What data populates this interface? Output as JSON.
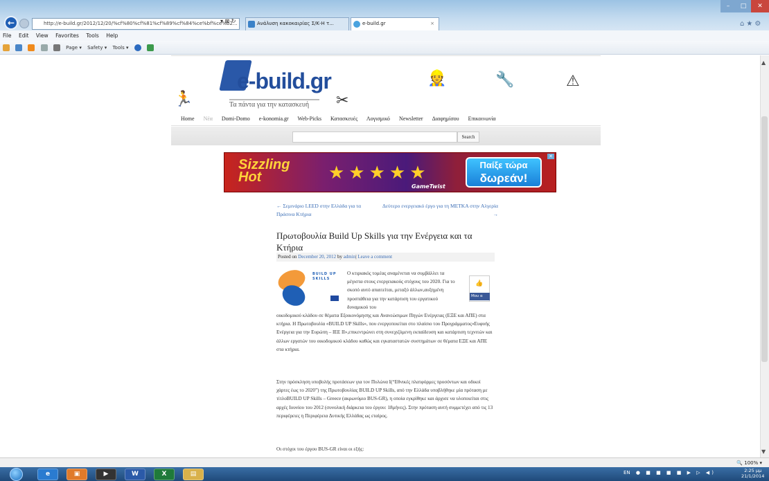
{
  "browser": {
    "address": "http://e-build.gr/2012/12/20/%cf%80%cf%81%cf%89%cf%84%ce%bf%ce%b2...",
    "tabs": [
      {
        "label": "Ανάλυση κακοκαιρίας Σ/Κ-Η τ..."
      },
      {
        "label": "e-build.gr"
      }
    ],
    "menu": [
      "File",
      "Edit",
      "View",
      "Favorites",
      "Tools",
      "Help"
    ],
    "commands": [
      "Page ▾",
      "Safety ▾",
      "Tools ▾"
    ],
    "zoom": "100%"
  },
  "site": {
    "logo": "e-build.gr",
    "tagline": "Τα πάντα για την κατασκευή",
    "nav": [
      "Home",
      "Nέα",
      "Domi-Domo",
      "e-konomia.gr",
      "Web-Picks",
      "Κατασκευές",
      "Λογισμικό",
      "Newsletter",
      "Διαφημίσου",
      "Επικοινωνία"
    ],
    "search_button": "Search"
  },
  "ad": {
    "left_text_1": "Sizzling",
    "left_text_2": "Hot",
    "brand": "GameTwist",
    "cta_1": "Παίξε τώρα",
    "cta_2": "δωρεάν!"
  },
  "post": {
    "prev": "← Σεμινάριο LEED στην Ελλάδα για τα Πράσινα Κτήρια",
    "next": "Δεύτερο ενεργειακό έργο για τη ΜΕΤΚΑ στην Αλγερία →",
    "title": "Πρωτοβουλία Build Up Skills για την Ενέργεια και τα Κτήρια",
    "meta_posted": "Posted on",
    "meta_date": "December 20, 2012",
    "meta_by": "by",
    "meta_author": "admin",
    "meta_sep": "|",
    "meta_comment": "Leave a comment",
    "image_text_1": "BUILD UP",
    "image_text_2": "SKILLS",
    "fb_label": "Μου α",
    "p1a": "Ο κτιριακός τομέας αναμένεται να συμβάλλει τα μέγιστα στους ενεργειακούς στόχους του 2020. Για το σκοπό αυτό απαιτείται, μεταξύ άλλων,αυξημένη προσπάθεια για την κατάρτιση του εργατικού δυναμικού του",
    "p1b": "οικοδομικού κλάδου σε θέματα Εξοικονόμησης και Ανανεώσιμων Πηγών Ενέργειας (ΕΞΕ και ΑΠΕ) στα κτήρια. Η Πρωτοβουλία «BUILD UP Skills», που ενεργοποιείται στο πλαίσιο του Προγράμματος«Ευφυής Ενέργεια για την Ευρώπη – ΙΕΕ ΙΙ»,επικεντρώνει στη συνεχιζόμενη εκπαίδευση και κατάρτιση τεχνιτών και άλλων εργατών του οικοδομικού κλάδου καθώς και εγκαταστατών συστημάτων σε θέματα ΕΞΕ και ΑΠΕ στα κτήρια.",
    "p2": "Στην πρόσκληση υποβολής προτάσεων για τον Πυλώνα Ι(“Εθνικές πλατφόρμες προσόντων και οδικοί χάρτες έως το 2020”) της Πρωτοβουλίας BUILD UP Skills, από την Ελλάδα υποβλήθηκε μία πρόταση με τίτλοBUILD UP Skills – Greece (ακρωνύμιο BUS-GR), η οποία εγκρίθηκε και άρχισε να υλοποιείται στις αρχές Ιουνίου του 2012 (συνολική διάρκεια του έργου: 18μήνες). Στην πρόταση αυτή συμμετέχει από τις 13 περιφέρειες η Περιφέρεια Δυτικής Ελλάδας ως εταίρος.",
    "p3": "Οι στόχοι του έργου BUS-GR είναι οι εξής:"
  },
  "taskbar": {
    "lang": "EN",
    "time": "2:25 μμ",
    "date": "21/1/2014"
  },
  "colors": {
    "link": "#3a6db5",
    "logo": "#234e9c",
    "taskbar": "#1f4a7a"
  }
}
